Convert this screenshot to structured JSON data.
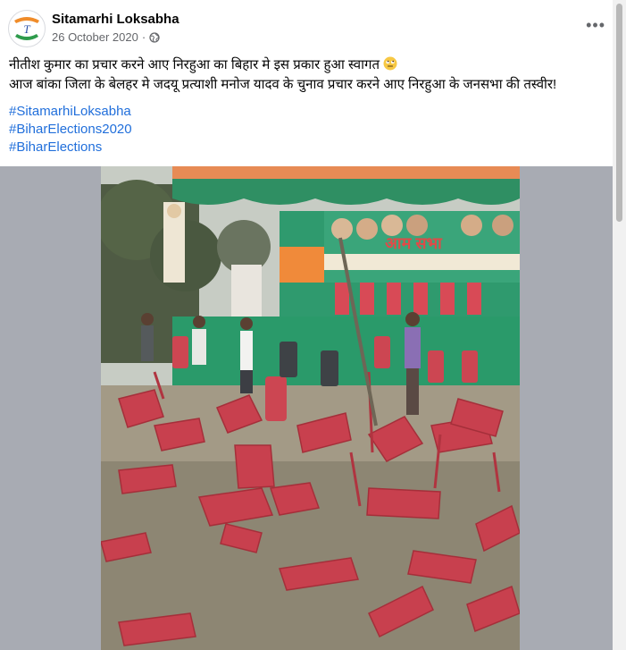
{
  "post": {
    "page_name": "Sitamarhi Loksabha",
    "date": "26 October 2020",
    "separator": "·",
    "privacy_icon": "globe-icon",
    "more_icon": "more-options-icon",
    "line1": "नीतीश कुमार का प्रचार करने आए निरहुआ का बिहार मे इस प्रकार हुआ स्वागत",
    "line1_emoji": "eye-roll-emoji",
    "line2": "आज बांका जिला के बेलहर मे जदयू प्रत्याशी मनोज यादव के चुनाव प्रचार करने आए निरहुआ के जनसभा की तस्वीर!",
    "hashtags": [
      "#SitamarhiLoksabha",
      "#BiharElections2020",
      "#BiharElections"
    ]
  },
  "photo": {
    "banner_text": "आम सभा",
    "description": "Rally ground with overturned red plastic chairs"
  },
  "colors": {
    "link": "#216fdb",
    "chair_red": "#c8404e",
    "stage_green": "#2a9a6a"
  }
}
